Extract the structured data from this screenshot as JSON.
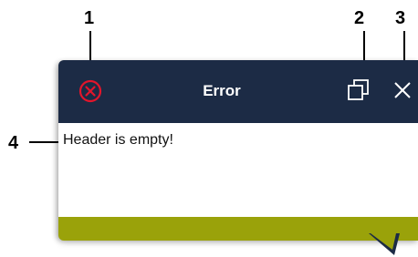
{
  "callouts": [
    {
      "num": "1"
    },
    {
      "num": "2"
    },
    {
      "num": "3"
    },
    {
      "num": "4"
    }
  ],
  "dialog": {
    "title": "Error",
    "message": "Header is empty!",
    "status_icon": "error-circle-x-icon",
    "copy_icon": "copy-icon",
    "close_icon": "close-icon"
  },
  "colors": {
    "titlebar": "#1c2b45",
    "error_icon": "#e3152b",
    "accent_bar": "#9aa20a",
    "title_text": "#ffffff"
  }
}
